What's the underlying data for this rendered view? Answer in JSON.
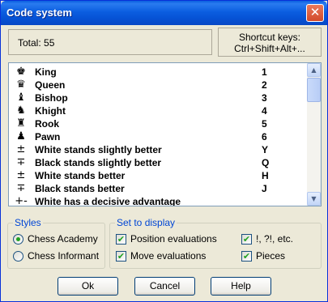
{
  "window": {
    "title": "Code system",
    "close_glyph": "✕"
  },
  "total": {
    "text": "Total: 55"
  },
  "shortcut": {
    "line1": "Shortcut keys:",
    "line2": "Ctrl+Shift+Alt+..."
  },
  "list": {
    "rows": [
      {
        "icon": "♚",
        "icon_name": "king-icon",
        "label": "King",
        "key": "1"
      },
      {
        "icon": "♛",
        "icon_name": "queen-icon",
        "label": "Queen",
        "key": "2"
      },
      {
        "icon": "♝",
        "icon_name": "bishop-icon",
        "label": "Bishop",
        "key": "3"
      },
      {
        "icon": "♞",
        "icon_name": "knight-icon",
        "label": "Khight",
        "key": "4"
      },
      {
        "icon": "♜",
        "icon_name": "rook-icon",
        "label": "Rook",
        "key": "5"
      },
      {
        "icon": "♟",
        "icon_name": "pawn-icon",
        "label": "Pawn",
        "key": "6"
      },
      {
        "icon": "±",
        "icon_name": "plus-minus-icon",
        "label": "White stands slightly better",
        "key": "Y"
      },
      {
        "icon": "∓",
        "icon_name": "minus-plus-icon",
        "label": "Black stands slightly better",
        "key": "Q"
      },
      {
        "icon": "±",
        "icon_name": "plus-minus-icon",
        "label": "White stands better",
        "key": "H"
      },
      {
        "icon": "∓",
        "icon_name": "minus-plus-icon",
        "label": "Black stands better",
        "key": "J"
      },
      {
        "icon": "+-",
        "icon_name": "plus-dash-icon",
        "label": "White has a decisive advantage",
        "key": ""
      }
    ]
  },
  "scrollbar": {
    "up_glyph": "▲",
    "down_glyph": "▼"
  },
  "styles": {
    "title": "Styles",
    "options": [
      {
        "label": "Chess Academy",
        "selected": true
      },
      {
        "label": "Chess Informant",
        "selected": false
      }
    ]
  },
  "display": {
    "title": "Set to display",
    "check_glyph": "✔",
    "options": [
      {
        "label": "Position evaluations",
        "checked": true
      },
      {
        "label": "Move evaluations",
        "checked": true
      },
      {
        "label": "!, ?!, etc.",
        "checked": true
      },
      {
        "label": "Pieces",
        "checked": true
      }
    ]
  },
  "buttons": {
    "ok": "Ok",
    "cancel": "Cancel",
    "help": "Help"
  }
}
